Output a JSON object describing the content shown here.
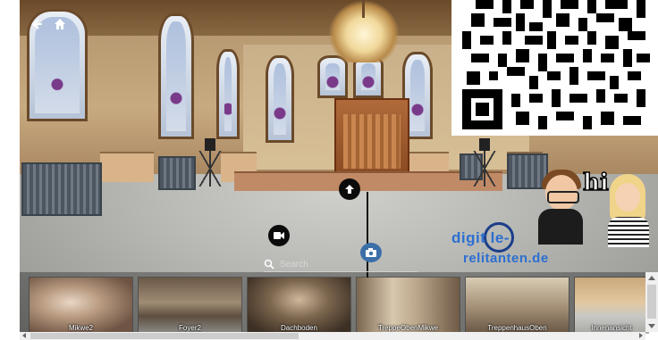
{
  "viewer": {
    "scene": "synagogue-hall-360-panorama"
  },
  "nav": {
    "back_icon": "arrow-left-icon",
    "home_icon": "home-icon"
  },
  "qr_code": {
    "icon": "qr-code-icon"
  },
  "hotspots": [
    {
      "icon": "arrow-up-icon",
      "color": "#0b0b0b"
    },
    {
      "icon": "video-camera-icon",
      "color": "#0b0b0b"
    },
    {
      "icon": "camera-icon",
      "color": "#3c6fa8"
    }
  ],
  "logo": {
    "line1": "digit  le-",
    "line2": "relitanten.de",
    "accent_color": "#2c6fd1"
  },
  "speech": "hi",
  "search": {
    "placeholder": "Search",
    "value": ""
  },
  "thumbnails": [
    {
      "label": "Mikwe2",
      "tone": "#8d6a52"
    },
    {
      "label": "Foyer2",
      "tone": "#7f6a58"
    },
    {
      "label": "Dachboden",
      "tone": "#5a4a3c"
    },
    {
      "label": "TreppeObenMikwe",
      "tone": "#a08a6c"
    },
    {
      "label": "TreppenhausOben",
      "tone": "#8a7a64"
    },
    {
      "label": "Innenansicht",
      "tone": "#b89a72"
    }
  ]
}
